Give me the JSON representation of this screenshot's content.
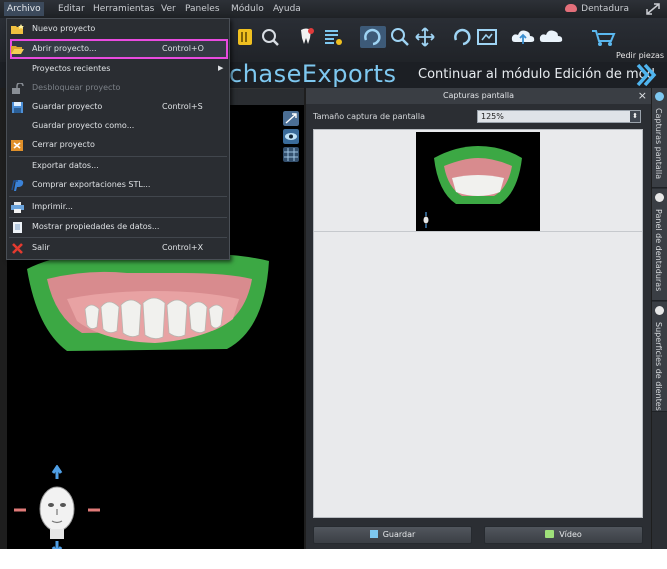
{
  "menubar": {
    "items": [
      "Archivo",
      "Editar",
      "Herramientas",
      "Ver",
      "Paneles",
      "Módulo",
      "Ayuda"
    ],
    "right_label": "Dentadura",
    "right_icon": "denture-icon"
  },
  "toolbar": {
    "order_label": "Pedir piezas"
  },
  "banner": {
    "brand_visible": "chaseExp",
    "brand_tail": "rts",
    "continue_label": "Continuar al módulo Edición de mod"
  },
  "file_menu": {
    "items": [
      {
        "label": "Nuevo proyecto",
        "shortcut": "",
        "icon": "folder-new-icon",
        "disabled": false
      },
      {
        "label": "Abrir proyecto...",
        "shortcut": "Control+O",
        "icon": "folder-open-icon",
        "disabled": false,
        "highlighted": true
      },
      {
        "label": "Proyectos recientes",
        "shortcut": "",
        "icon": "",
        "disabled": false,
        "submenu": true
      },
      {
        "label": "Desbloquear proyecto",
        "shortcut": "",
        "icon": "unlock-icon",
        "disabled": true
      },
      {
        "label": "Guardar proyecto",
        "shortcut": "Control+S",
        "icon": "floppy-icon",
        "disabled": false
      },
      {
        "label": "Guardar proyecto como...",
        "shortcut": "",
        "icon": "",
        "disabled": false
      },
      {
        "label": "Cerrar proyecto",
        "shortcut": "",
        "icon": "close-project-icon",
        "disabled": false
      },
      {
        "label": "Exportar datos...",
        "shortcut": "",
        "icon": "",
        "disabled": false
      },
      {
        "label": "Comprar exportaciones STL...",
        "shortcut": "",
        "icon": "paypal-icon",
        "disabled": false
      },
      {
        "label": "Imprimir...",
        "shortcut": "",
        "icon": "printer-icon",
        "disabled": false
      },
      {
        "label": "Mostrar propiedades de datos...",
        "shortcut": "",
        "icon": "document-icon",
        "disabled": false
      },
      {
        "label": "Salir",
        "shortcut": "Control+X",
        "icon": "exit-x-icon",
        "disabled": false
      }
    ],
    "submenu_arrow": "▶"
  },
  "capture_panel": {
    "title": "Capturas pantalla",
    "close": "×",
    "size_label": "Tamaño captura de pantalla",
    "size_value": "125%",
    "save_button": "Guardar",
    "video_button": "Vídeo"
  },
  "side_tabs": [
    {
      "label": "Capturas pantalla",
      "icon": "camera-icon"
    },
    {
      "label": "Panel de dentaduras",
      "icon": "denture-panel-icon"
    },
    {
      "label": "Superficies de dientes",
      "icon": "tooth-icon"
    }
  ],
  "colors": {
    "accent_blue": "#7ec8f0",
    "highlight_border": "#e84be0",
    "gum_pink": "#d98a8f",
    "model_green": "#3bb54a"
  }
}
